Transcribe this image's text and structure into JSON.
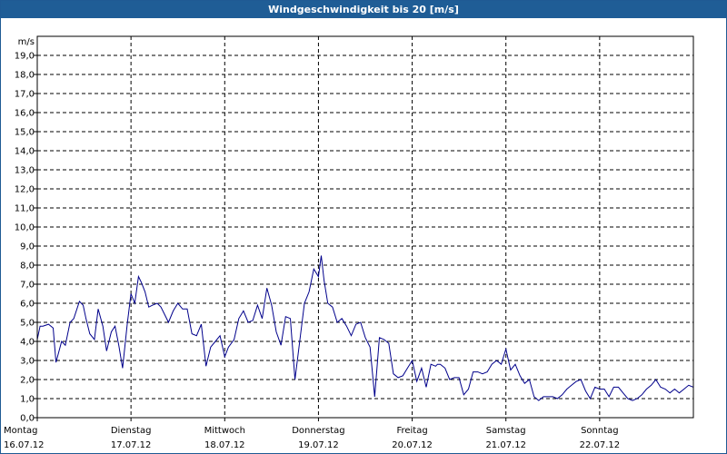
{
  "window": {
    "title": "Windgeschwindigkeit bis 20 [m/s]"
  },
  "chart_data": {
    "type": "line",
    "title": "Windgeschwindigkeit bis 20 [m/s]",
    "ylabel": "m/s",
    "ylim": [
      0,
      20
    ],
    "xlim": [
      0,
      7
    ],
    "grid": true,
    "y_ticks": [
      "0,0",
      "1,0",
      "2,0",
      "3,0",
      "4,0",
      "5,0",
      "6,0",
      "7,0",
      "8,0",
      "9,0",
      "10,0",
      "11,0",
      "12,0",
      "13,0",
      "14,0",
      "15,0",
      "16,0",
      "17,0",
      "18,0",
      "19,0"
    ],
    "x_ticks": [
      {
        "day": "Montag",
        "date": "16.07.12"
      },
      {
        "day": "Dienstag",
        "date": "17.07.12"
      },
      {
        "day": "Mittwoch",
        "date": "18.07.12"
      },
      {
        "day": "Donnerstag",
        "date": "19.07.12"
      },
      {
        "day": "Freitag",
        "date": "20.07.12"
      },
      {
        "day": "Samstag",
        "date": "21.07.12"
      },
      {
        "day": "Sonntag",
        "date": "22.07.12"
      }
    ],
    "series": [
      {
        "color": "#00008b",
        "x": [
          0.0,
          0.03,
          0.06,
          0.12,
          0.17,
          0.2,
          0.26,
          0.3,
          0.35,
          0.39,
          0.45,
          0.49,
          0.52,
          0.56,
          0.61,
          0.65,
          0.7,
          0.74,
          0.79,
          0.83,
          0.87,
          0.91,
          0.96,
          1.0,
          1.04,
          1.08,
          1.11,
          1.15,
          1.19,
          1.23,
          1.28,
          1.32,
          1.36,
          1.4,
          1.45,
          1.5,
          1.55,
          1.6,
          1.65,
          1.7,
          1.75,
          1.8,
          1.85,
          1.9,
          1.95,
          2.0,
          2.04,
          2.1,
          2.15,
          2.2,
          2.25,
          2.3,
          2.35,
          2.4,
          2.45,
          2.5,
          2.55,
          2.6,
          2.65,
          2.7,
          2.75,
          2.8,
          2.85,
          2.9,
          2.95,
          3.0,
          3.03,
          3.06,
          3.1,
          3.15,
          3.2,
          3.25,
          3.3,
          3.35,
          3.4,
          3.45,
          3.5,
          3.55,
          3.6,
          3.65,
          3.7,
          3.75,
          3.8,
          3.85,
          3.9,
          3.95,
          4.0,
          4.05,
          4.1,
          4.15,
          4.2,
          4.25,
          4.27,
          4.3,
          4.35,
          4.4,
          4.45,
          4.5,
          4.55,
          4.6,
          4.65,
          4.7,
          4.75,
          4.8,
          4.85,
          4.9,
          4.95,
          5.0,
          5.05,
          5.1,
          5.15,
          5.2,
          5.25,
          5.3,
          5.35,
          5.4,
          5.45,
          5.5,
          5.55,
          5.6,
          5.65,
          5.7,
          5.75,
          5.8,
          5.85,
          5.9,
          5.95,
          6.0,
          6.05,
          6.1,
          6.15,
          6.2,
          6.25,
          6.3,
          6.35,
          6.4,
          6.45,
          6.5,
          6.55,
          6.6,
          6.65,
          6.7,
          6.75,
          6.8,
          6.85,
          6.9,
          6.95,
          7.0
        ],
        "y": [
          4.1,
          4.8,
          4.8,
          4.9,
          4.7,
          2.9,
          4.0,
          3.8,
          5.0,
          5.2,
          6.1,
          5.9,
          5.2,
          4.4,
          4.1,
          5.7,
          4.8,
          3.5,
          4.5,
          4.8,
          3.8,
          2.6,
          4.9,
          6.5,
          6.0,
          7.4,
          7.1,
          6.6,
          5.8,
          5.9,
          6.0,
          5.8,
          5.4,
          5.0,
          5.6,
          6.0,
          5.7,
          5.7,
          4.4,
          4.3,
          4.9,
          2.7,
          3.7,
          4.0,
          4.3,
          3.2,
          3.7,
          4.1,
          5.2,
          5.6,
          5.0,
          5.1,
          5.9,
          5.2,
          6.8,
          5.9,
          4.5,
          3.8,
          5.3,
          5.2,
          2.0,
          4.0,
          6.0,
          6.6,
          7.8,
          7.4,
          8.5,
          7.2,
          6.0,
          5.8,
          5.0,
          5.2,
          4.8,
          4.3,
          4.9,
          5.0,
          4.2,
          3.7,
          1.1,
          4.2,
          4.1,
          3.9,
          2.3,
          2.1,
          2.2,
          2.6,
          3.0,
          1.9,
          2.6,
          1.6,
          2.8,
          2.7,
          2.8,
          2.8,
          2.6,
          2.0,
          2.1,
          2.1,
          1.2,
          1.5,
          2.4,
          2.4,
          2.3,
          2.4,
          2.8,
          3.0,
          2.8,
          3.6,
          2.5,
          2.8,
          2.2,
          1.8,
          2.0,
          1.1,
          0.9,
          1.1,
          1.1,
          1.1,
          1.0,
          1.2,
          1.5,
          1.7,
          1.9,
          2.0,
          1.4,
          1.0,
          1.6,
          1.5,
          1.5,
          1.1,
          1.6,
          1.6,
          1.3,
          1.0,
          0.9,
          1.0,
          1.2,
          1.5,
          1.7,
          2.0,
          1.6,
          1.5,
          1.3,
          1.5,
          1.3,
          1.5,
          1.7,
          1.6
        ]
      }
    ]
  }
}
